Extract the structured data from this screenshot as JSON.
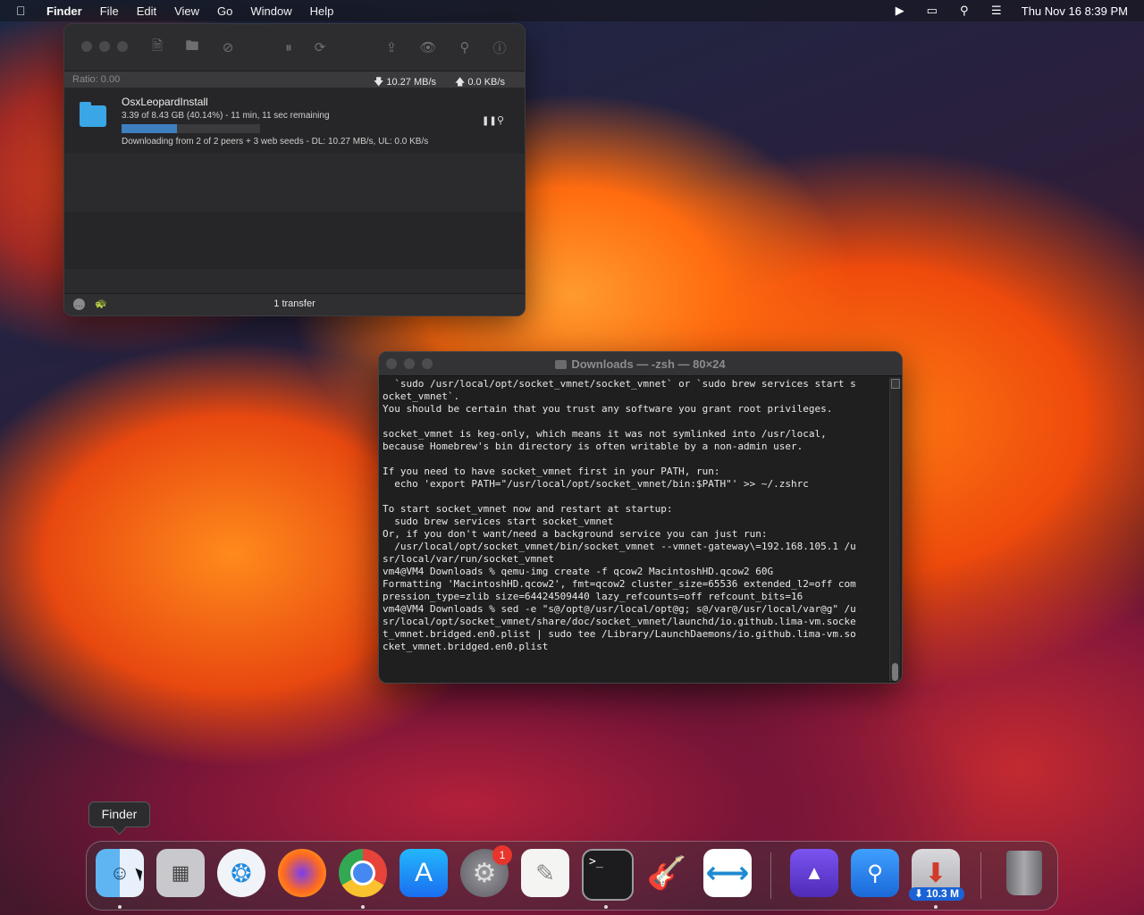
{
  "menubar": {
    "app_name": "Finder",
    "menus": [
      "File",
      "Edit",
      "View",
      "Go",
      "Window",
      "Help"
    ],
    "datetime": "Thu Nov 16  8:39 PM",
    "status_icons": [
      "play-circle-icon",
      "screens-icon",
      "search-icon",
      "control-center-icon"
    ]
  },
  "transmission": {
    "ratio": "Ratio: 0.00",
    "download_speed": "10.27 MB/s",
    "upload_speed": "0.0 KB/s",
    "transfer": {
      "name": "OsxLeopardInstall",
      "progress_text": "3.39 of 8.43 GB (40.14%) - 11 min, 11 sec remaining",
      "progress_fraction": 0.4014,
      "detail": "Downloading from 2 of 2 peers + 3 web seeds - DL: 10.27 MB/s, UL: 0.0 KB/s",
      "pause_label": "⏸",
      "inspect_label": "🔍"
    },
    "footer_count": "1 transfer",
    "toolbar_icons": [
      "open-torrent-icon",
      "folder-icon",
      "remove-icon",
      "pause-all-icon",
      "resume-all-icon",
      "share-icon",
      "quicklook-icon",
      "search-icon",
      "info-icon"
    ],
    "colors": {
      "progress": "#3d7fbf"
    }
  },
  "terminal": {
    "title": "Downloads — -zsh — 80×24",
    "lines": [
      "  `sudo /usr/local/opt/socket_vmnet/socket_vmnet` or `sudo brew services start s",
      "ocket_vmnet`.",
      "You should be certain that you trust any software you grant root privileges.",
      "",
      "socket_vmnet is keg-only, which means it was not symlinked into /usr/local,",
      "because Homebrew's bin directory is often writable by a non-admin user.",
      "",
      "If you need to have socket_vmnet first in your PATH, run:",
      "  echo 'export PATH=\"/usr/local/opt/socket_vmnet/bin:$PATH\"' >> ~/.zshrc",
      "",
      "To start socket_vmnet now and restart at startup:",
      "  sudo brew services start socket_vmnet",
      "Or, if you don't want/need a background service you can just run:",
      "  /usr/local/opt/socket_vmnet/bin/socket_vmnet --vmnet-gateway\\=192.168.105.1 /u",
      "sr/local/var/run/socket_vmnet",
      "vm4@VM4 Downloads % qemu-img create -f qcow2 MacintoshHD.qcow2 60G",
      "Formatting 'MacintoshHD.qcow2', fmt=qcow2 cluster_size=65536 extended_l2=off com",
      "pression_type=zlib size=64424509440 lazy_refcounts=off refcount_bits=16",
      "vm4@VM4 Downloads % sed -e \"s@/opt@/usr/local/opt@g; s@/var@/usr/local/var@g\" /u",
      "sr/local/opt/socket_vmnet/share/doc/socket_vmnet/launchd/io.github.lima-vm.socke",
      "t_vmnet.bridged.en0.plist | sudo tee /Library/LaunchDaemons/io.github.lima-vm.so",
      "cket_vmnet.bridged.en0.plist"
    ]
  },
  "dock": {
    "tooltip": "Finder",
    "apps": [
      {
        "name": "finder",
        "icon": "finder-icon",
        "running": true
      },
      {
        "name": "launchpad",
        "icon": "launchpad-icon",
        "running": false
      },
      {
        "name": "safari",
        "icon": "safari-icon",
        "running": false
      },
      {
        "name": "firefox",
        "icon": "firefox-icon",
        "running": false
      },
      {
        "name": "chrome",
        "icon": "chrome-icon",
        "running": true
      },
      {
        "name": "app-store",
        "icon": "app-store-icon",
        "running": false
      },
      {
        "name": "system-settings",
        "icon": "settings-icon",
        "running": false,
        "badge": "1"
      },
      {
        "name": "textedit",
        "icon": "textedit-icon",
        "running": false
      },
      {
        "name": "terminal",
        "icon": "terminal-icon",
        "running": true
      },
      {
        "name": "garageband",
        "icon": "garageband-icon",
        "running": false
      },
      {
        "name": "vscode",
        "icon": "vscode-icon",
        "running": false
      },
      {
        "name": "xcode-sim",
        "icon": "purple-app-icon",
        "running": false
      },
      {
        "name": "keynote",
        "icon": "keynote-icon",
        "running": false
      },
      {
        "name": "transmission",
        "icon": "transmission-icon",
        "running": true,
        "badge": "⬇ 10.3 M"
      },
      {
        "name": "trash",
        "icon": "trash-icon",
        "running": false
      }
    ]
  }
}
